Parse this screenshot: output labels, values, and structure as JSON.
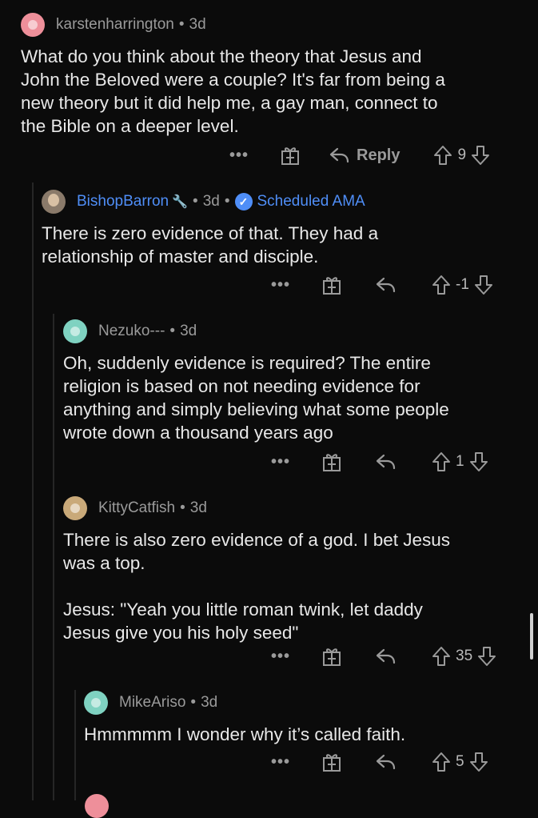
{
  "comments": [
    {
      "username": "karstenharrington",
      "age": "3d",
      "body": "What do you think about the theory that Jesus and\nJohn the Beloved were a couple? It's far from being a\nnew theory but it did help me, a gay man, connect to\nthe Bible on a deeper level.",
      "reply_label": "Reply",
      "score": "9",
      "avatar_icon": "reddit-avatar-pink"
    },
    {
      "username": "BishopBarron",
      "age": "3d",
      "flair": "Scheduled AMA",
      "body": "There is zero evidence of that.  They had a\nrelationship of master and disciple.",
      "score": "-1",
      "avatar_icon": "photo-avatar"
    },
    {
      "username": "Nezuko---",
      "age": "3d",
      "body": "Oh, suddenly evidence is required? The entire\nreligion is based on not needing evidence for\nanything and simply believing what some people\nwrote down a thousand years ago",
      "score": "1",
      "avatar_icon": "reddit-avatar-teal"
    },
    {
      "username": "KittyCatfish",
      "age": "3d",
      "body": "There is also zero evidence of a god. I bet Jesus\nwas a top.\n\nJesus: \"Yeah you little roman twink, let daddy\nJesus give you his holy seed\"",
      "score": "35",
      "avatar_icon": "cat-avatar"
    },
    {
      "username": "MikeAriso",
      "age": "3d",
      "body": "Hmmmmm I wonder why it’s called faith.",
      "score": "5",
      "avatar_icon": "reddit-avatar-teal"
    }
  ],
  "ui": {
    "more_label": "•••",
    "separator": "•",
    "check_glyph": "✓",
    "accent_color": "#4f8ef7",
    "background_color": "#0b0b0b"
  }
}
